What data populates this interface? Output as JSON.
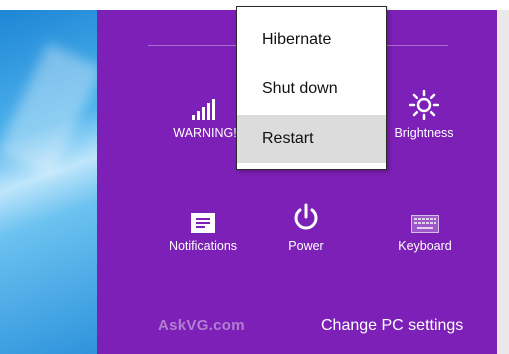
{
  "power_menu": {
    "items": [
      {
        "label": "Hibernate"
      },
      {
        "label": "Shut down"
      },
      {
        "label": "Restart"
      }
    ],
    "highlighted_index": 2
  },
  "settings_charm": {
    "tiles": [
      {
        "label": "WARNING!",
        "icon": "network-signal-icon"
      },
      {
        "label": "Brightness",
        "icon": "brightness-icon"
      },
      {
        "label": "Notifications",
        "icon": "notifications-icon"
      },
      {
        "label": "Power",
        "icon": "power-icon"
      },
      {
        "label": "Keyboard",
        "icon": "keyboard-icon"
      }
    ],
    "footer_link": "Change PC settings"
  },
  "watermark": "AskVG.com",
  "colors": {
    "charm_background": "#7d20b7",
    "menu_highlight": "#dcdcdc"
  }
}
